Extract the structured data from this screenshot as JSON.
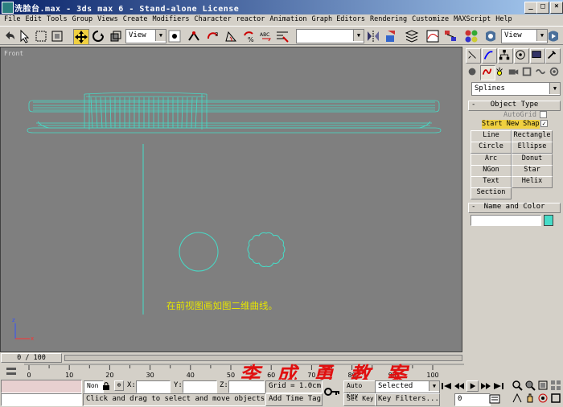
{
  "window": {
    "title": "洗脸台.max - 3ds max 6 - Stand-alone License"
  },
  "menu": [
    "File",
    "Edit",
    "Tools",
    "Group",
    "Views",
    "Create",
    "Modifiers",
    "Character",
    "reactor",
    "Animation",
    "Graph Editors",
    "Rendering",
    "Customize",
    "MAXScript",
    "Help"
  ],
  "toolbar": {
    "ref_coord": "View",
    "ref_coord2": "View",
    "named_selection": ""
  },
  "viewport": {
    "label": "Front",
    "caption": "在前视图画如图二维曲线。",
    "colors": {
      "background": "#7f7f7f",
      "wire": "#46dcc8",
      "caption": "#e6e600"
    }
  },
  "command_panel": {
    "category": "Splines",
    "object_type_title": "Object Type",
    "autogrid": "AutoGrid",
    "start_new_shape": "Start New Shape",
    "buttons": [
      "Line",
      "Rectangle",
      "Circle",
      "Ellipse",
      "Arc",
      "Donut",
      "NGon",
      "Star",
      "Text",
      "Helix",
      "Section"
    ],
    "name_color_title": "Name and Color",
    "name_value": "",
    "object_color": "#46dcc8"
  },
  "timeline": {
    "frame_display": "0 / 100",
    "ticks": [
      "0",
      "10",
      "20",
      "30",
      "40",
      "50",
      "60",
      "70",
      "80",
      "90",
      "100"
    ]
  },
  "status": {
    "selection": "Non",
    "x_label": "X:",
    "y_label": "Y:",
    "z_label": "Z:",
    "grid": "Grid = 1.0cm",
    "auto_key": "Auto Key",
    "set_key": "Set Key",
    "key_mode": "Selected",
    "key_filters": "Key Filters...",
    "add_time_tag": "Add Time Tag",
    "prompt": "Click and drag to select and move objects",
    "frame": "0"
  },
  "watermark": "李 成 勇 教 案"
}
